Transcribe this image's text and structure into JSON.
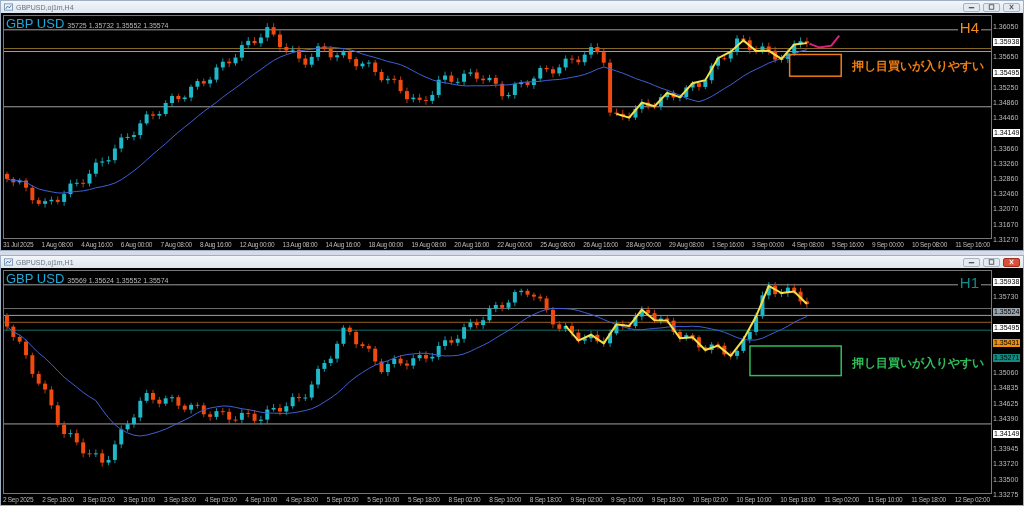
{
  "windows": [
    {
      "title": "GBPUSD,oj1m,H4",
      "active": false,
      "symbol_label": "GBP USD",
      "ohlc": "35725 1.35732 1.35552 1.35574",
      "timeframe": {
        "text": "H4",
        "color": "#f08c1e"
      },
      "annotation": {
        "text": "押し目買いが入りやすい",
        "color": "#f07d10"
      },
      "price_axis": [
        {
          "text": "1.36050",
          "kind": "tick"
        },
        {
          "text": "1.35938",
          "kind": "marker",
          "color": "#ffffff"
        },
        {
          "text": "1.35650",
          "kind": "tick"
        },
        {
          "text": "1.35495",
          "kind": "marker",
          "color": "#ffffff"
        },
        {
          "text": "1.35250",
          "kind": "tick"
        },
        {
          "text": "1.34860",
          "kind": "tick"
        },
        {
          "text": "1.34460",
          "kind": "tick"
        },
        {
          "text": "1.34149",
          "kind": "marker",
          "color": "#ffffff"
        },
        {
          "text": "1.33660",
          "kind": "tick"
        },
        {
          "text": "1.33260",
          "kind": "tick"
        },
        {
          "text": "1.32860",
          "kind": "tick"
        },
        {
          "text": "1.32460",
          "kind": "tick"
        },
        {
          "text": "1.32070",
          "kind": "tick"
        },
        {
          "text": "1.31670",
          "kind": "tick"
        },
        {
          "text": "1.31270",
          "kind": "tick"
        }
      ],
      "time_axis": [
        "31 Jul 2025",
        "1 Aug 08:00",
        "4 Aug 16:00",
        "6 Aug 00:00",
        "7 Aug 08:00",
        "8 Aug 16:00",
        "12 Aug 00:00",
        "13 Aug 08:00",
        "14 Aug 16:00",
        "18 Aug 00:00",
        "19 Aug 08:00",
        "20 Aug 16:00",
        "22 Aug 00:00",
        "25 Aug 08:00",
        "26 Aug 16:00",
        "28 Aug 00:00",
        "29 Aug 08:00",
        "1 Sep 16:00",
        "3 Sep 00:00",
        "4 Sep 08:00",
        "5 Sep 16:00",
        "9 Sep 00:00",
        "10 Sep 08:00",
        "11 Sep 16:00"
      ]
    },
    {
      "title": "GBPUSD,oj1m,H1",
      "active": true,
      "symbol_label": "GBP USD",
      "ohlc": "35569 1.35624 1.35552 1.35574",
      "timeframe": {
        "text": "H1",
        "color": "#138a8a"
      },
      "annotation": {
        "text": "押し目買いが入りやすい",
        "color": "#2fbf5a"
      },
      "price_axis": [
        {
          "text": "1.35938",
          "kind": "marker",
          "color": "#ffffff"
        },
        {
          "text": "1.35730",
          "kind": "tick"
        },
        {
          "text": "1.35524",
          "kind": "marker",
          "color": "#9aa4ad"
        },
        {
          "text": "1.35495",
          "kind": "marker",
          "color": "#ffffff"
        },
        {
          "text": "1.35431",
          "kind": "marker",
          "color": "#f0900a"
        },
        {
          "text": "1.35271",
          "kind": "marker",
          "color": "#138a80"
        },
        {
          "text": "1.35060",
          "kind": "tick"
        },
        {
          "text": "1.34835",
          "kind": "tick"
        },
        {
          "text": "1.34625",
          "kind": "tick"
        },
        {
          "text": "1.34390",
          "kind": "tick"
        },
        {
          "text": "1.34149",
          "kind": "marker",
          "color": "#ffffff"
        },
        {
          "text": "1.33945",
          "kind": "tick"
        },
        {
          "text": "1.33720",
          "kind": "tick"
        },
        {
          "text": "1.33500",
          "kind": "tick"
        },
        {
          "text": "1.33275",
          "kind": "tick"
        }
      ],
      "time_axis": [
        "2 Sep 2025",
        "2 Sep 18:00",
        "3 Sep 02:00",
        "3 Sep 10:00",
        "3 Sep 18:00",
        "4 Sep 02:00",
        "4 Sep 10:00",
        "4 Sep 18:00",
        "5 Sep 02:00",
        "5 Sep 10:00",
        "5 Sep 18:00",
        "8 Sep 02:00",
        "8 Sep 10:00",
        "8 Sep 18:00",
        "9 Sep 02:00",
        "9 Sep 10:00",
        "9 Sep 18:00",
        "10 Sep 02:00",
        "10 Sep 10:00",
        "10 Sep 18:00",
        "11 Sep 02:00",
        "11 Sep 10:00",
        "11 Sep 18:00",
        "12 Sep 02:00"
      ]
    }
  ]
}
